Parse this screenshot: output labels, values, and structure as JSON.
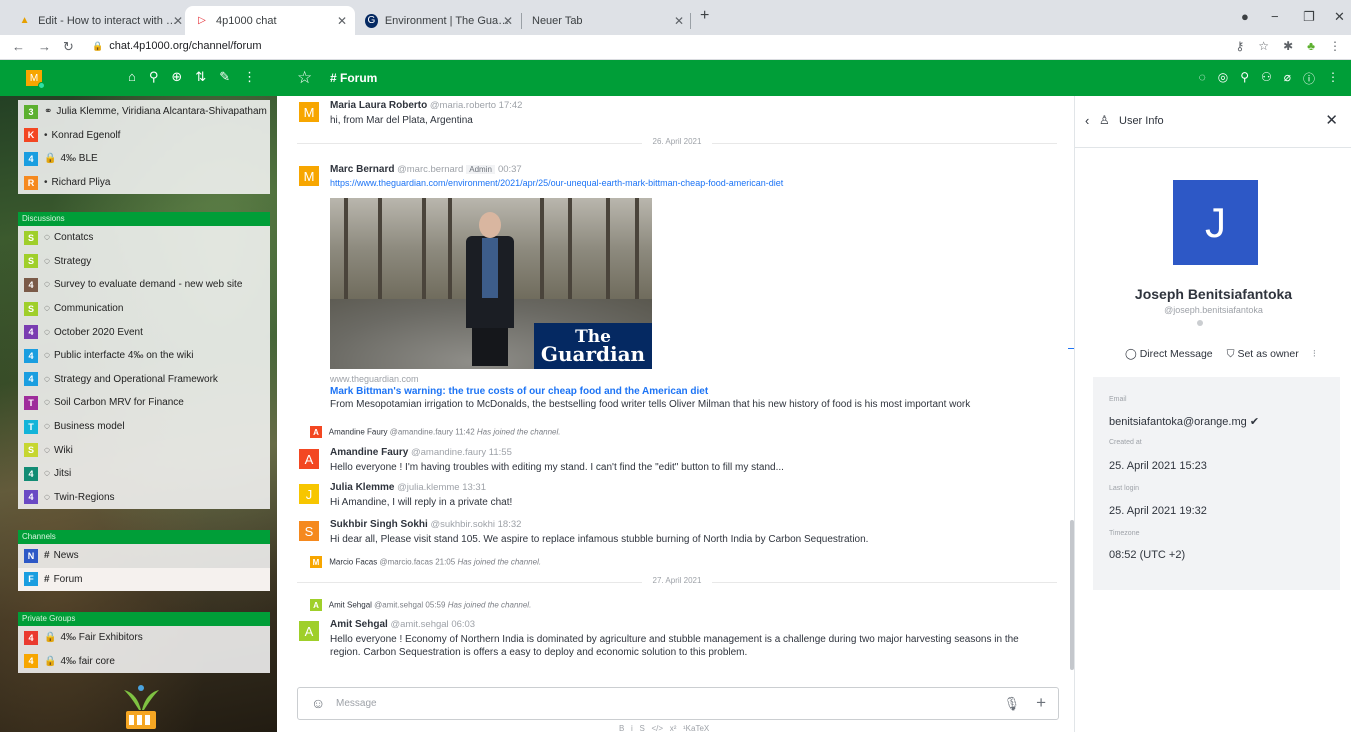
{
  "browser": {
    "tabs": [
      {
        "title": "Edit - How to interact with other",
        "active": false
      },
      {
        "title": "4p1000 chat",
        "active": true
      },
      {
        "title": "Environment | The Guardian",
        "active": false
      },
      {
        "title": "Neuer Tab",
        "active": false
      }
    ],
    "url": "chat.4p1000.org/channel/forum"
  },
  "sidebar": {
    "user_initial": "M",
    "direct": [
      {
        "badge": "3",
        "color": "#5cb02f",
        "icon": "👥",
        "label": "Julia Klemme, Viridiana Alcantara-Shivapatham"
      },
      {
        "badge": "K",
        "color": "#f34722",
        "icon": "•",
        "label": "Konrad Egenolf"
      },
      {
        "badge": "4",
        "color": "#1a9ee0",
        "icon": "🔒",
        "label": "4‰ BLE"
      },
      {
        "badge": "R",
        "color": "#f5891e",
        "icon": "•",
        "label": "Richard Pliya"
      }
    ],
    "discussions_header": "Discussions",
    "discussions": [
      {
        "badge": "S",
        "color": "#9fcf2a",
        "label": "Contatcs"
      },
      {
        "badge": "S",
        "color": "#9fcf2a",
        "label": "Strategy"
      },
      {
        "badge": "4",
        "color": "#7a5a48",
        "label": "Survey to evaluate demand - new web site"
      },
      {
        "badge": "S",
        "color": "#9fcf2a",
        "label": "Communication"
      },
      {
        "badge": "4",
        "color": "#7a3db1",
        "label": "October 2020 Event"
      },
      {
        "badge": "4",
        "color": "#1a9ee0",
        "label": "Public interfacte 4‰ on the wiki"
      },
      {
        "badge": "4",
        "color": "#1a9ee0",
        "label": "Strategy and Operational Framework"
      },
      {
        "badge": "T",
        "color": "#9e2c9b",
        "label": "Soil Carbon MRV for Finance"
      },
      {
        "badge": "T",
        "color": "#13b4d9",
        "label": "Business model"
      },
      {
        "badge": "S",
        "color": "#c6d630",
        "label": "Wiki"
      },
      {
        "badge": "4",
        "color": "#128c74",
        "label": "Jitsi"
      },
      {
        "badge": "4",
        "color": "#6a49c4",
        "label": "Twin-Regions"
      }
    ],
    "channels_header": "Channels",
    "channels": [
      {
        "badge": "N",
        "color": "#2d58c6",
        "label": "News"
      },
      {
        "badge": "F",
        "color": "#1a9ee0",
        "label": "Forum"
      }
    ],
    "private_header": "Private Groups",
    "private": [
      {
        "badge": "4",
        "color": "#ea3a2f",
        "label": "4‰ Fair Exhibitors"
      },
      {
        "badge": "4",
        "color": "#f7a600",
        "label": "4‰ fair core"
      }
    ]
  },
  "room": {
    "title": "# Forum"
  },
  "messages": {
    "m1": {
      "initial": "M",
      "name": "Maria Laura Roberto",
      "user": "@maria.roberto",
      "time": "17:42",
      "text": "hi, from Mar del Plata, Argentina"
    },
    "day1": "26. April 2021",
    "m2": {
      "initial": "M",
      "name": "Marc Bernard",
      "user": "@marc.bernard",
      "role": "Admin",
      "time": "00:37",
      "link": "https://www.theguardian.com/environment/2021/apr/25/our-unequal-earth-mark-bittman-cheap-food-american-diet"
    },
    "preview": {
      "logo_line1": "The",
      "logo_line2": "Guardian",
      "domain": "www.theguardian.com",
      "title": "Mark Bittman's warning: the true costs of our cheap food and the American diet",
      "desc": "From Mesopotamian irrigation to McDonalds, the bestselling food writer tells Oliver Milman that his new history of food is his most important work"
    },
    "s1": {
      "initial": "A",
      "name": "Amandine Faury",
      "user": "@amandine.faury",
      "time": "11:42",
      "text": "Has joined the channel."
    },
    "m3": {
      "initial": "A",
      "name": "Amandine Faury",
      "user": "@amandine.faury",
      "time": "11:55",
      "text": "Hello everyone ! I'm having troubles with editing my stand. I can't find the \"edit\" button to fill my stand..."
    },
    "m4": {
      "initial": "J",
      "name": "Julia Klemme",
      "user": "@julia.klemme",
      "time": "13:31",
      "text": "Hi Amandine, I will reply in a private chat!"
    },
    "m5": {
      "initial": "S",
      "name": "Sukhbir Singh Sokhi",
      "user": "@sukhbir.sokhi",
      "time": "18:32",
      "text": "Hi dear all, Please visit stand 105. We aspire to replace infamous stubble burning of North India by Carbon Sequestration."
    },
    "s2": {
      "initial": "M",
      "name": "Marcio Facas",
      "user": "@marcio.facas",
      "time": "21:05",
      "text": "Has joined the channel."
    },
    "day2": "27. April 2021",
    "s3": {
      "initial": "A",
      "name": "Amit Sehgal",
      "user": "@amit.sehgal",
      "time": "05:59",
      "text": "Has joined the channel."
    },
    "m6": {
      "initial": "A",
      "name": "Amit Sehgal",
      "user": "@amit.sehgal",
      "time": "06:03",
      "text1": "Hello everyone ! Economy of Northern India is dominated by agriculture and stubble management is a challenge during two major harvesting seasons in the",
      "text2": "region. Carbon Sequestration is offers a easy to deploy and economic solution to this problem."
    }
  },
  "composer": {
    "placeholder": "Message"
  },
  "user_info": {
    "header": "User Info",
    "initial": "J",
    "name": "Joseph Benitsiafantoka",
    "username": "@joseph.benitsiafantoka",
    "direct_message": "Direct Message",
    "set_owner": "Set as owner",
    "email_label": "Email",
    "email": "benitsiafantoka@orange.mg",
    "created_label": "Created at",
    "created": "25. April 2021 15:23",
    "login_label": "Last login",
    "login": "25. April 2021 19:32",
    "tz_label": "Timezone",
    "tz": "08:52 (UTC +2)"
  },
  "colors": {
    "brand_green": "#009e38",
    "link_blue": "#1d74f5"
  }
}
